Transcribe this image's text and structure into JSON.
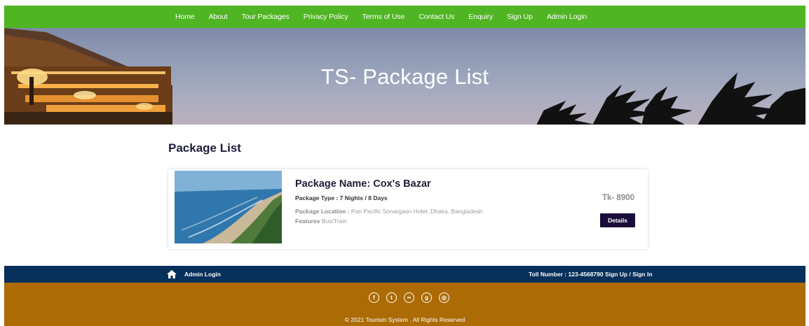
{
  "nav": {
    "items": [
      {
        "label": "Home"
      },
      {
        "label": "About"
      },
      {
        "label": "Tour Packages"
      },
      {
        "label": "Privacy Policy"
      },
      {
        "label": "Terms of Use"
      },
      {
        "label": "Contact Us"
      },
      {
        "label": "Enquiry"
      },
      {
        "label": "Sign Up"
      },
      {
        "label": "Admin Login"
      }
    ]
  },
  "banner": {
    "title": "TS- Package List"
  },
  "main": {
    "section_title": "Package List",
    "package": {
      "name": "Package Name: Cox's Bazar",
      "type": "Package Type : 7 Nights / 8 Days",
      "location_label": "Package Location :",
      "location_value": "Pan Pacific Sonargaon Hotel, Dhaka, Bangladesh",
      "features_label": "Features",
      "features_value": "Bus/Train",
      "price": "Tk- 8900",
      "details_label": "Details"
    }
  },
  "footer_bar": {
    "admin_login": "Admin Login",
    "toll_number": "Toll Number : 123-4568790",
    "signup": "Sign Up / Sign In"
  },
  "footer": {
    "socials": [
      "facebook-icon",
      "twitter-icon",
      "flickr-icon",
      "google-plus-icon",
      "dribbble-icon"
    ],
    "copyright": "© 2021 Tourism System . All Rights Reserved"
  },
  "colors": {
    "nav_bg": "#4fb522",
    "footer_bar_bg": "#07305a",
    "footer_bg": "#ac6b05",
    "button_bg": "#1b0d3a"
  }
}
